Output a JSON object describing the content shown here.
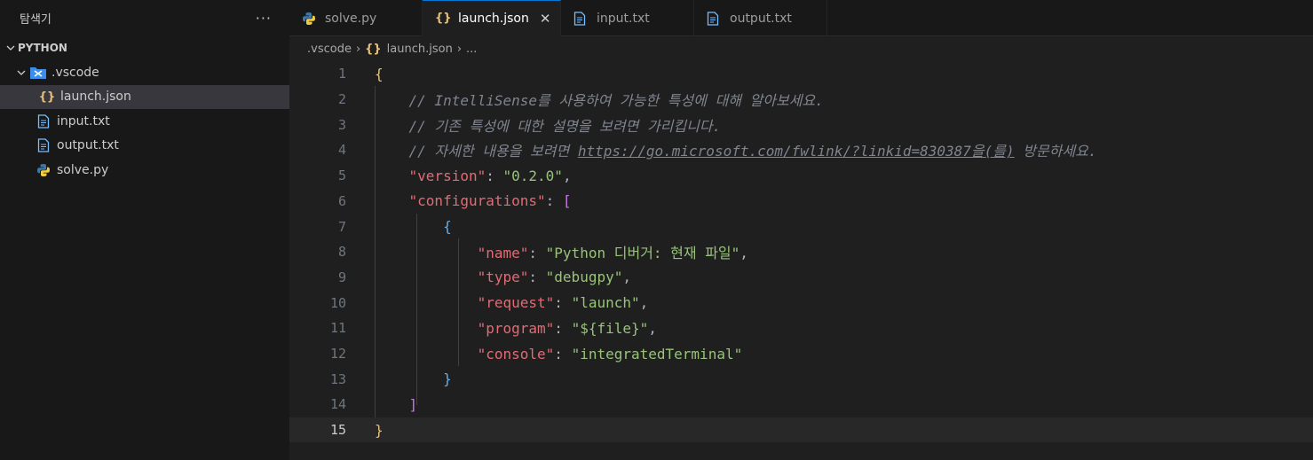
{
  "sidebar": {
    "title": "탐색기",
    "more": "···",
    "section": "PYTHON",
    "items": [
      {
        "label": ".vscode",
        "icon": "vscode-folder-icon"
      },
      {
        "label": "launch.json",
        "icon": "json-braces-icon"
      },
      {
        "label": "input.txt",
        "icon": "file-text-icon"
      },
      {
        "label": "output.txt",
        "icon": "file-text-icon"
      },
      {
        "label": "solve.py",
        "icon": "python-icon"
      }
    ]
  },
  "tabs": [
    {
      "label": "solve.py",
      "icon": "python-icon"
    },
    {
      "label": "launch.json",
      "icon": "json-braces-icon",
      "active": true
    },
    {
      "label": "input.txt",
      "icon": "file-text-icon"
    },
    {
      "label": "output.txt",
      "icon": "file-text-icon"
    }
  ],
  "breadcrumb": {
    "folder": ".vscode",
    "file": "launch.json",
    "more": "..."
  },
  "editor": {
    "line_numbers": [
      "1",
      "2",
      "3",
      "4",
      "5",
      "6",
      "7",
      "8",
      "9",
      "10",
      "11",
      "12",
      "13",
      "14",
      "15"
    ],
    "current_line": "15",
    "comment1": "// IntelliSense를 사용하여 가능한 특성에 대해 알아보세요.",
    "comment2": "// 기존 특성에 대한 설명을 보려면 가리킵니다.",
    "comment3_prefix": "// 자세한 내용을 보려면 ",
    "comment3_link": "https://go.microsoft.com/fwlink/?linkid=830387을(를)",
    "comment3_suffix": " 방문하세요.",
    "version_key": "\"version\"",
    "version_value": "\"0.2.0\"",
    "configurations_key": "\"configurations\"",
    "config": [
      {
        "key": "\"name\"",
        "value": "\"Python 디버거: 현재 파일\""
      },
      {
        "key": "\"type\"",
        "value": "\"debugpy\""
      },
      {
        "key": "\"request\"",
        "value": "\"launch\""
      },
      {
        "key": "\"program\"",
        "value": "\"${file}\""
      },
      {
        "key": "\"console\"",
        "value": "\"integratedTerminal\""
      }
    ]
  }
}
